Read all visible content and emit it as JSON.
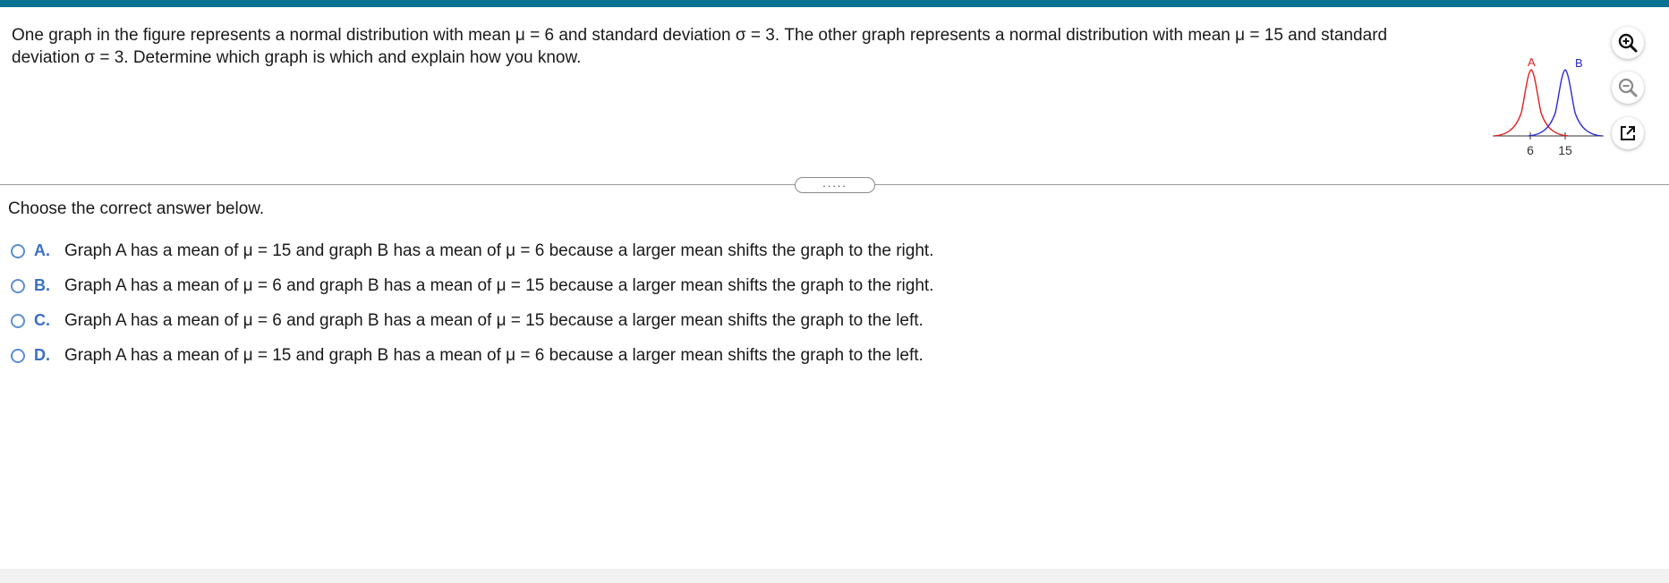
{
  "question": {
    "text": "One graph in the figure represents a normal distribution with mean μ = 6 and standard deviation σ = 3. The other graph represents a normal distribution with mean μ = 15 and standard deviation σ = 3. Determine which graph is which and explain how you know."
  },
  "figure": {
    "label_a": "A",
    "label_b": "B",
    "tick_left": "6",
    "tick_right": "15",
    "color_a": "#e02020",
    "color_b": "#2a2ad8"
  },
  "toolbar": {
    "zoom_in_icon": "zoom-in-icon",
    "zoom_out_icon": "zoom-out-icon",
    "popout_icon": "external-window-icon"
  },
  "divider": {
    "handle_text": "....."
  },
  "prompt": "Choose the correct answer below.",
  "options": [
    {
      "letter": "A.",
      "text": "Graph A has a mean of μ = 15 and graph B has a mean of μ = 6 because a larger mean shifts the graph to the right."
    },
    {
      "letter": "B.",
      "text": "Graph A has a mean of μ = 6 and graph B has a mean of μ = 15 because a larger mean shifts the graph to the right."
    },
    {
      "letter": "C.",
      "text": "Graph A has a mean of μ = 6 and graph B has a mean of μ = 15 because a larger mean shifts the graph to the left."
    },
    {
      "letter": "D.",
      "text": "Graph A has a mean of μ = 15 and graph B has a mean of μ = 6 because a larger mean shifts the graph to the left."
    }
  ],
  "colors": {
    "accent_bar": "#0c7492",
    "radio": "#5b8ed6",
    "option_letter": "#3a6fc4"
  }
}
